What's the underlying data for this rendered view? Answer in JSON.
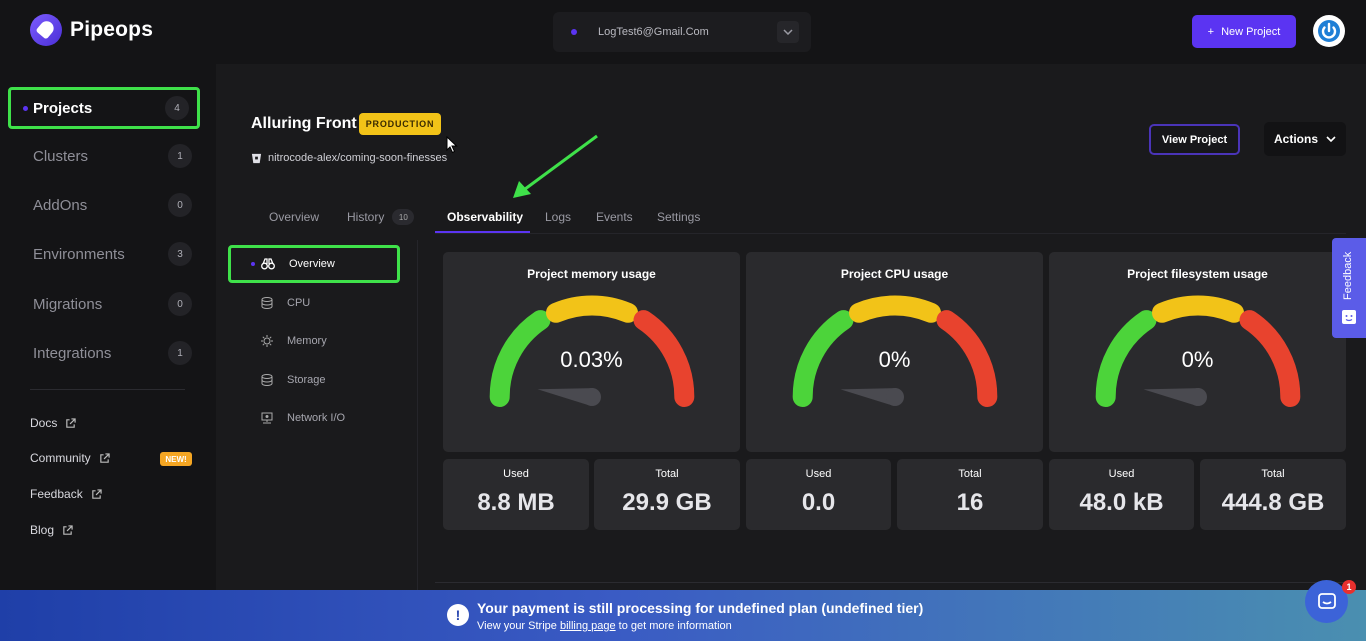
{
  "brand": {
    "name": "Pipeops"
  },
  "account": {
    "email": "LogTest6@Gmail.Com"
  },
  "header": {
    "new_project_label": "New Project"
  },
  "sidebar": {
    "items": [
      {
        "label": "Projects",
        "count": "4"
      },
      {
        "label": "Clusters",
        "count": "1"
      },
      {
        "label": "AddOns",
        "count": "0"
      },
      {
        "label": "Environments",
        "count": "3"
      },
      {
        "label": "Migrations",
        "count": "0"
      },
      {
        "label": "Integrations",
        "count": "1"
      }
    ],
    "links": [
      {
        "label": "Docs"
      },
      {
        "label": "Community",
        "badge": "NEW!"
      },
      {
        "label": "Feedback"
      },
      {
        "label": "Blog"
      }
    ]
  },
  "project": {
    "name": "Alluring Front",
    "environment_badge": "PRODUCTION",
    "repo": "nitrocode-alex/coming-soon-finesses",
    "view_label": "View Project",
    "actions_label": "Actions"
  },
  "tabs": [
    {
      "label": "Overview"
    },
    {
      "label": "History",
      "count": "10"
    },
    {
      "label": "Observability",
      "active": true
    },
    {
      "label": "Logs"
    },
    {
      "label": "Events"
    },
    {
      "label": "Settings"
    }
  ],
  "subnav": [
    {
      "label": "Overview",
      "active": true
    },
    {
      "label": "CPU"
    },
    {
      "label": "Memory"
    },
    {
      "label": "Storage"
    },
    {
      "label": "Network I/O"
    }
  ],
  "gauges": [
    {
      "title": "Project memory usage",
      "value": "0.03%",
      "level": 0.0003,
      "used_label": "Used",
      "used": "8.8 MB",
      "total_label": "Total",
      "total": "29.9 GB"
    },
    {
      "title": "Project CPU usage",
      "value": "0%",
      "level": 0,
      "used_label": "Used",
      "used": "0.0",
      "total_label": "Total",
      "total": "16"
    },
    {
      "title": "Project filesystem usage",
      "value": "0%",
      "level": 0,
      "used_label": "Used",
      "used": "48.0 kB",
      "total_label": "Total",
      "total": "444.8 GB"
    }
  ],
  "feedback_tab": {
    "label": "Feedback"
  },
  "banner": {
    "title": "Your payment is still processing for undefined plan (undefined tier)",
    "sub_prefix": "View your Stripe ",
    "sub_link": "billing page",
    "sub_suffix": " to get more information"
  },
  "chat": {
    "badge": "1"
  },
  "colors": {
    "accent": "#5b34f2",
    "highlight": "#3fe14a",
    "badge": "#f2c318",
    "gauge_green": "#4cd43a",
    "gauge_yellow": "#f2c318",
    "gauge_red": "#e8432e"
  }
}
